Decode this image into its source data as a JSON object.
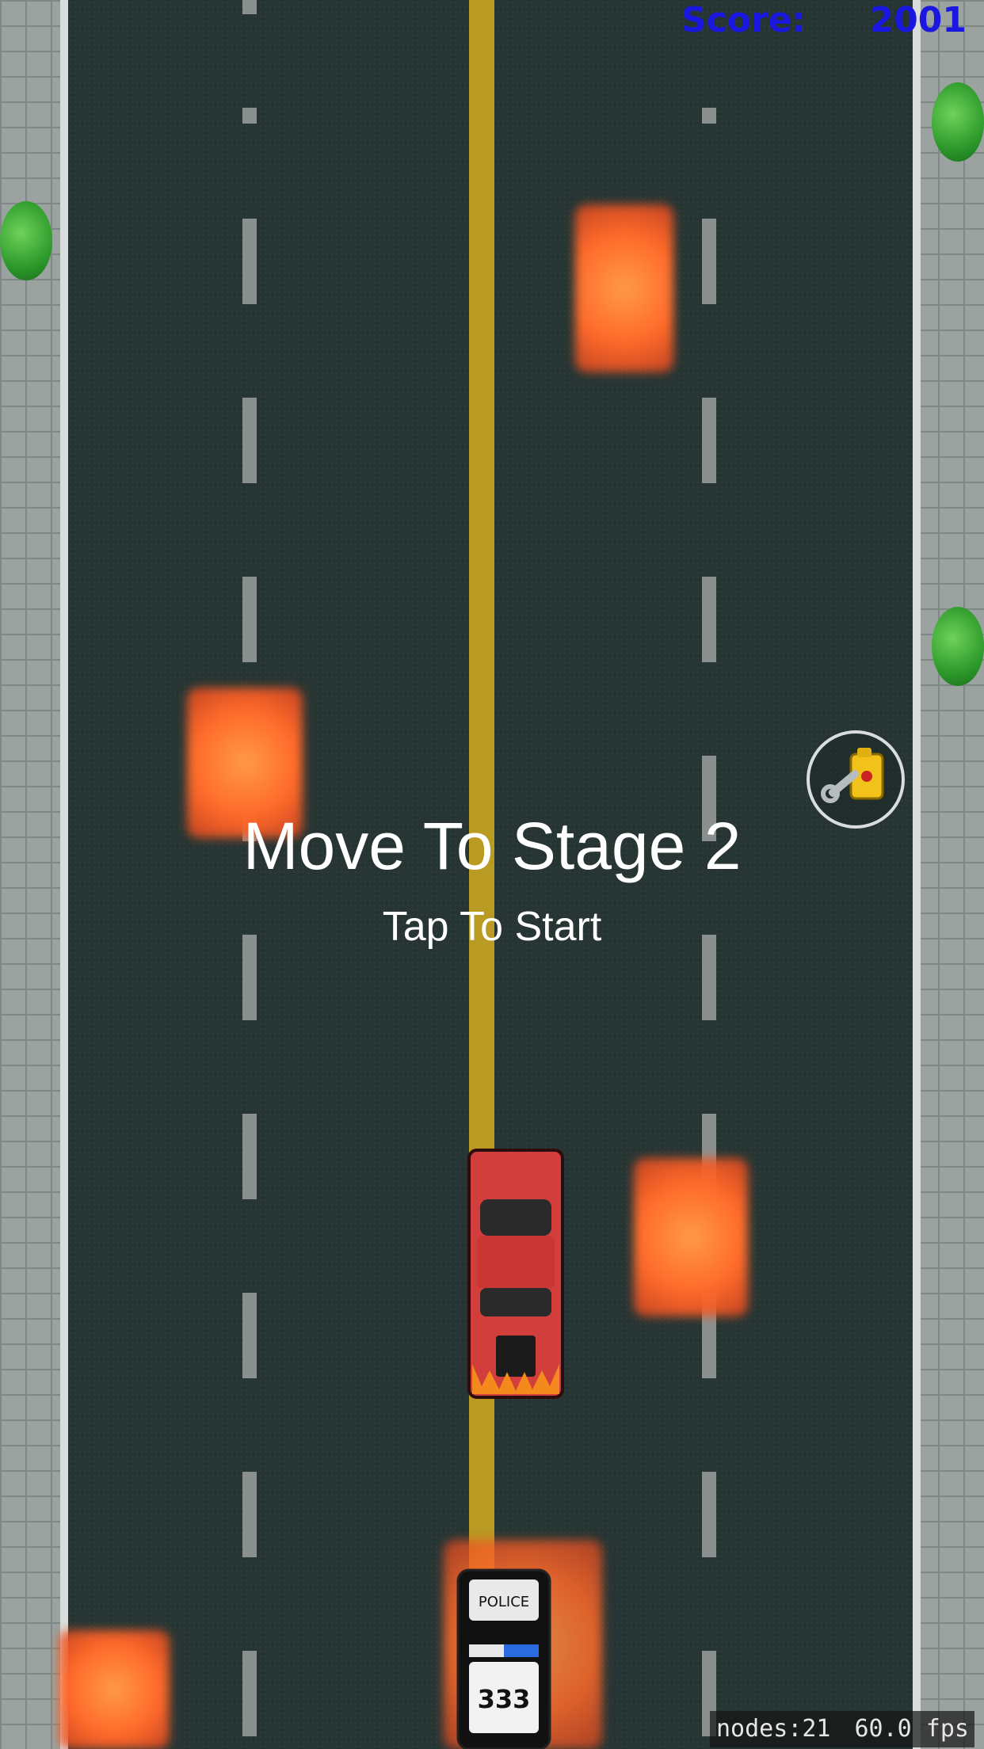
{
  "hud": {
    "score_label": "Score:",
    "score_value": "2001"
  },
  "overlay": {
    "title": "Move To Stage 2",
    "subtitle": "Tap To Start"
  },
  "debug": {
    "nodes": "nodes:21",
    "fps": "60.0 fps"
  },
  "sprites": {
    "player_car": "red-hot-rod-car",
    "enemy_car": "police-car",
    "enemy_car_number": "333",
    "enemy_car_roof_text": "POLICE",
    "powerup_icon": "wrench-fuel-can-icon",
    "obstacle": "fire-blob",
    "tree": "tree"
  },
  "colors": {
    "score": "#1a17e0",
    "road": "#263533",
    "center_line": "#b99a22",
    "text": "#ffffff"
  }
}
